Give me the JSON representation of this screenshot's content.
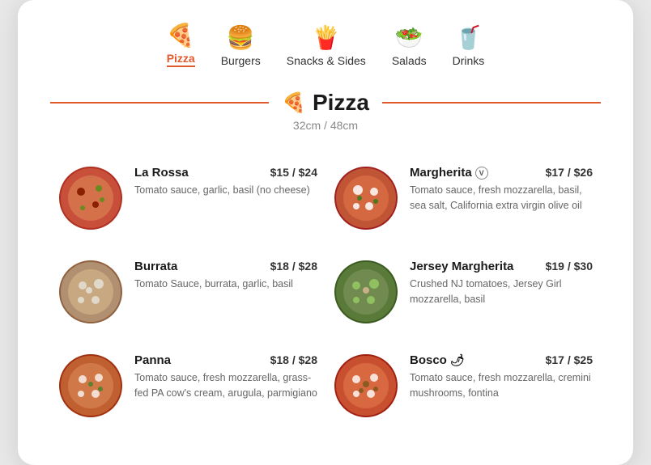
{
  "nav": {
    "items": [
      {
        "label": "Pizza",
        "icon": "🍕",
        "active": true
      },
      {
        "label": "Burgers",
        "icon": "🍔",
        "active": false
      },
      {
        "label": "Snacks & Sides",
        "icon": "🍟",
        "active": false
      },
      {
        "label": "Salads",
        "icon": "🥗",
        "active": false
      },
      {
        "label": "Drinks",
        "icon": "🥤",
        "active": false
      }
    ]
  },
  "section": {
    "title": "Pizza",
    "subtitle": "32cm / 48cm"
  },
  "menu_items": [
    {
      "name": "La Rossa",
      "badge": null,
      "price": "$15 / $24",
      "desc": "Tomato sauce, garlic, basil (no cheese)",
      "img_color": "#c8503a",
      "side": "left"
    },
    {
      "name": "Margherita",
      "badge": "V",
      "price": "$17 / $26",
      "desc": "Tomato sauce, fresh mozzarella, basil, sea salt, California extra virgin olive oil",
      "img_color": "#d45f30",
      "side": "right"
    },
    {
      "name": "Burrata",
      "badge": null,
      "price": "$18 / $28",
      "desc": "Tomato Sauce, burrata, garlic, basil",
      "img_color": "#b8a080",
      "side": "left"
    },
    {
      "name": "Jersey Margherita",
      "badge": null,
      "price": "$19 / $30",
      "desc": "Crushed NJ tomatoes, Jersey Girl mozzarella, basil",
      "img_color": "#5a7a3a",
      "side": "right"
    },
    {
      "name": "Panna",
      "badge": null,
      "price": "$18 / $28",
      "desc": "Tomato sauce, fresh mozzarella, grass-fed PA cow's cream, arugula, parmigiano",
      "img_color": "#c06030",
      "side": "left"
    },
    {
      "name": "Bosco",
      "badge": "chili",
      "price": "$17 / $25",
      "desc": "Tomato sauce, fresh mozzarella, cremini mushrooms, fontina",
      "img_color": "#c85030",
      "side": "right"
    }
  ]
}
